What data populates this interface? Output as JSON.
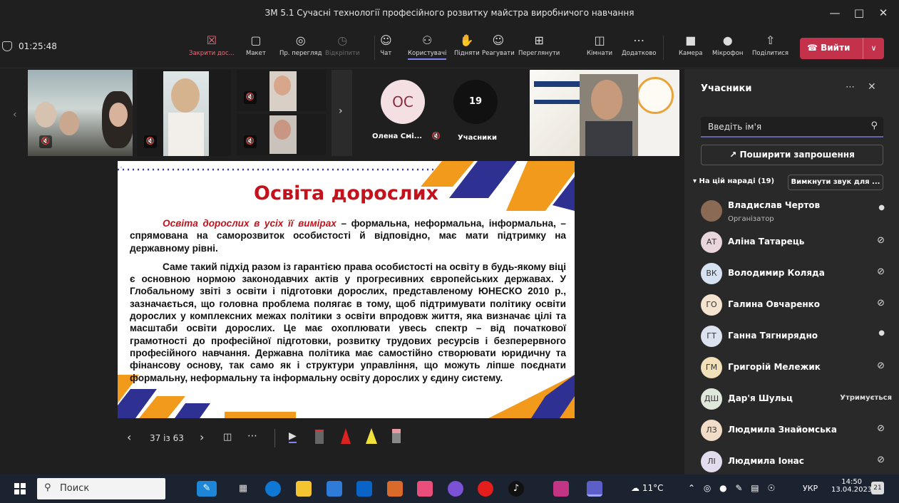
{
  "window": {
    "title": "ЗМ 5.1 Сучасні технології професійного розвитку майстра виробничого навчання"
  },
  "meeting": {
    "timer": "01:25:48"
  },
  "toolbar": {
    "close_share": "Закрити дос...",
    "layout": "Макет",
    "presenter_view": "Пр. перегляд",
    "unpin": "Відкріпити",
    "chat": "Чат",
    "users": "Користувачі",
    "raise": "Підняти",
    "react": "Реагувати",
    "view": "Переглянути",
    "rooms": "Кімнати",
    "more": "Додатково",
    "camera": "Камера",
    "mic": "Мікрофон",
    "share": "Поділитися",
    "leave": "Вийти"
  },
  "gallery": {
    "avatar_initials": "ОС",
    "avatar_name": "Олена Смі...",
    "count": "19",
    "count_label": "Учасники"
  },
  "slide": {
    "title": "Освіта дорослих",
    "p1_lead": "Освіта дорослих в усіх її вимірах",
    "p1_rest": " – формальна, неформальна, інформальна, – спрямована на саморозвиток особистості й відповідно, має мати підтримку на державному рівні.",
    "p2": "Саме такий підхід разом із гарантією права особистості на освіту в будь-якому віці є основною нормою законодавчих актів у прогресивних європейських державах. У Глобальному звіті з освіти і підготовки дорослих, представленому ЮНЕСКО 2010 р., зазначається, що головна проблема полягає в тому, щоб підтримувати політику освіти дорослих у комплексних межах політики з освіти впродовж життя, яка визначає цілі та масштаби освіти дорослих. Це має охоплювати увесь спектр – від початкової грамотності до професійної підготовки, розвитку трудових ресурсів і безперервного професійного навчання. Державна політика має самостійно створювати юридичну та фінансову основу, так само як і структури управління, що можуть ліпше поєднати формальну, неформальну та інформальну освіту дорослих у єдину систему."
  },
  "slide_nav": {
    "counter": "37 із 63"
  },
  "panel": {
    "title": "Учасники",
    "search_placeholder": "Введіть ім'я",
    "invite": "Поширити запрошення",
    "section": "На цій нараді (19)",
    "mute_all": "Вимкнути звук для ...",
    "people": [
      {
        "initials": "",
        "name": "Владислав Чертов",
        "role": "Організатор",
        "status": "mic-on",
        "color": "#8a6a55"
      },
      {
        "initials": "АТ",
        "name": "Аліна Татарець",
        "role": "",
        "status": "mic-off",
        "color": "#e9d6dd"
      },
      {
        "initials": "ВК",
        "name": "Володимир Коляда",
        "role": "",
        "status": "mic-off",
        "color": "#d6e2f2"
      },
      {
        "initials": "ГО",
        "name": "Галина Овчаренко",
        "role": "",
        "status": "mic-off",
        "color": "#f3e3cf"
      },
      {
        "initials": "ГТ",
        "name": "Ганна Тягнирядно",
        "role": "",
        "status": "mic-on",
        "color": "#dde3ee"
      },
      {
        "initials": "ГМ",
        "name": "Григорій Мележик",
        "role": "",
        "status": "mic-off",
        "color": "#f2e0b8"
      },
      {
        "initials": "ДШ",
        "name": "Дар'я Шульц",
        "role": "",
        "status": "Утримується",
        "color": "#dfe6da"
      },
      {
        "initials": "ЛЗ",
        "name": "Людмила Знайомська",
        "role": "",
        "status": "mic-off",
        "color": "#f1dcc8"
      },
      {
        "initials": "ЛІ",
        "name": "Людмила Іонас",
        "role": "",
        "status": "mic-off",
        "color": "#e2dcee"
      }
    ]
  },
  "taskbar": {
    "search": "Поиск",
    "weather": "11°C",
    "lang": "УКР",
    "time": "14:50",
    "date": "13.04.2023",
    "notif": "21"
  }
}
